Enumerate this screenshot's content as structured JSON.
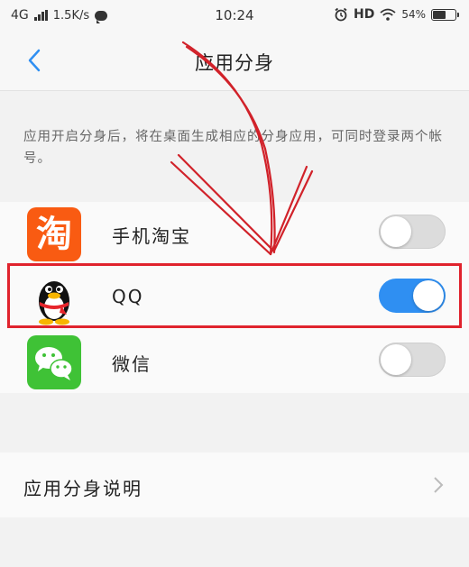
{
  "status_bar": {
    "network": "4G",
    "speed": "1.5K/s",
    "time": "10:24",
    "hd": "HD",
    "battery_percent_text": "54%",
    "battery_level": 0.54
  },
  "header": {
    "title": "应用分身"
  },
  "description": "应用开启分身后，将在桌面生成相应的分身应用，可同时登录两个帐号。",
  "apps": [
    {
      "name": "手机淘宝",
      "icon": "taobao-icon",
      "icon_char": "淘",
      "enabled": false
    },
    {
      "name": "QQ",
      "icon": "qq-penguin-icon",
      "enabled": true
    },
    {
      "name": "微信",
      "icon": "wechat-icon",
      "enabled": false
    }
  ],
  "explain": {
    "label": "应用分身说明"
  },
  "colors": {
    "toggle_on": "#2f8ff2",
    "toggle_off": "#dcdcdc",
    "highlight": "#e0232d",
    "taobao": "#f95b12",
    "wechat": "#3fc236",
    "back_arrow": "#2f8ff2"
  }
}
